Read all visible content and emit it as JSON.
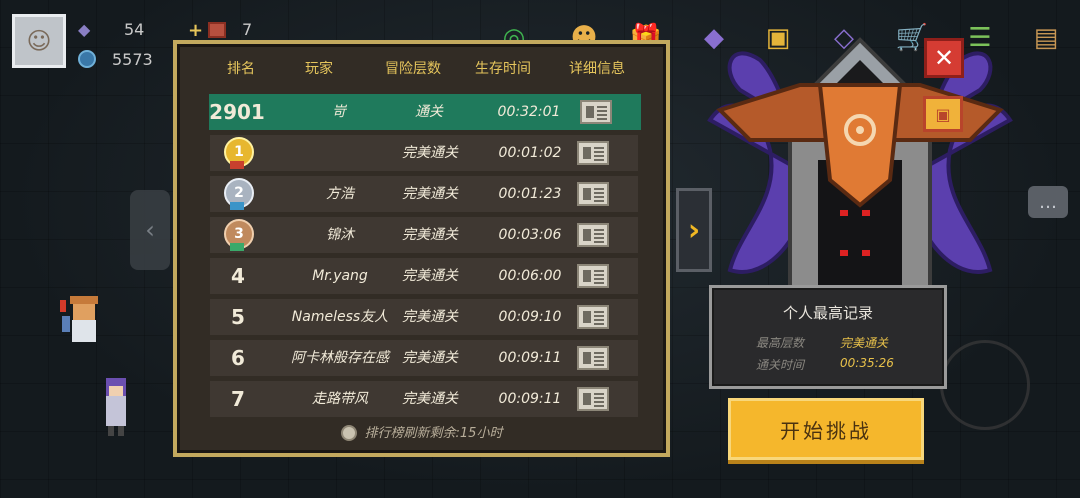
{
  "hud": {
    "gems": "54",
    "coins": "5573",
    "materials": "7",
    "gem_icon": "gem-icon",
    "coin_icon": "coin-icon"
  },
  "leaderboard": {
    "headers": [
      "排名",
      "玩家",
      "冒险层数",
      "生存时间",
      "详细信息"
    ],
    "rows": [
      {
        "rank": "2901",
        "player": "岢",
        "floor": "通关",
        "time": "00:32:01",
        "highlight": true
      },
      {
        "rank": "1",
        "medal": "gold",
        "player": "",
        "floor": "完美通关",
        "time": "00:01:02"
      },
      {
        "rank": "2",
        "medal": "silver",
        "player": "方浩",
        "floor": "完美通关",
        "time": "00:01:23"
      },
      {
        "rank": "3",
        "medal": "bronze",
        "player": "锦沐",
        "floor": "完美通关",
        "time": "00:03:06"
      },
      {
        "rank": "4",
        "player": "Mr.yang",
        "floor": "完美通关",
        "time": "00:06:00"
      },
      {
        "rank": "5",
        "player": "Nameless友人",
        "floor": "完美通关",
        "time": "00:09:10"
      },
      {
        "rank": "6",
        "player": "阿卡林般存在感",
        "floor": "完美通关",
        "time": "00:09:11"
      },
      {
        "rank": "7",
        "player": "走路带风",
        "floor": "完美通关",
        "time": "00:09:11"
      }
    ],
    "refresh_text": "排行榜刷新剩余:15小时"
  },
  "record": {
    "title": "个人最高记录",
    "floor_label": "最高层数",
    "floor_value": "完美通关",
    "time_label": "通关时间",
    "time_value": "00:35:26"
  },
  "start_button": "开始挑战",
  "colors": {
    "panel_border": "#c3a95e",
    "header_text": "#e5c55c",
    "highlight_row": "#1f7a5c",
    "start_button": "#f5b72c",
    "close_button": "#d53c33"
  }
}
